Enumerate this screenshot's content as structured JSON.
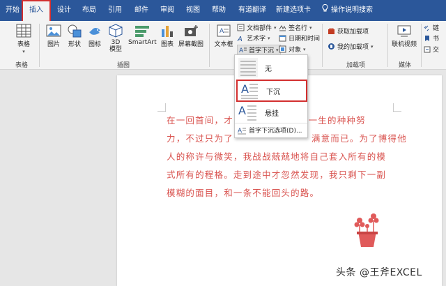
{
  "tabs": [
    "开始",
    "插入",
    "设计",
    "布局",
    "引用",
    "邮件",
    "审阅",
    "视图",
    "帮助",
    "有道翻译",
    "新建选项卡",
    "操作说明搜索"
  ],
  "ribbon": {
    "table": "表格",
    "pictures": "图片",
    "shapes": "形状",
    "icons": "图标",
    "models3d": "3D\n模型",
    "smartart": "SmartArt",
    "chart": "图表",
    "screenshot": "屏幕截图",
    "textbox": "文本框",
    "docparts": "文档部件",
    "wordart": "艺术字",
    "dropcap": "首字下沉",
    "signature": "签名行",
    "datetime": "日期和时间",
    "object": "对象",
    "get_addins": "获取加载项",
    "my_addins": "我的加载项",
    "online_video": "联机视频",
    "link": "链",
    "bookmark": "书",
    "crossref": "交",
    "group_tables": "表格",
    "group_illustrations": "插图",
    "group_addins": "加载项",
    "group_media": "媒体"
  },
  "dropcap_menu": {
    "none": "无",
    "dropped": "下沉",
    "in_margin": "悬挂",
    "options": "首字下沉选项(D)..."
  },
  "doc": {
    "lines": [
      "在一回首间，才",
      "力，不过只为了",
      "人的称许与微笑，我战战兢兢地将自己套入所有的模",
      "式所有的程格。走到途中才忽然发现，我只剩下一副",
      "模糊的面目，和一条不能回头的路。"
    ],
    "line1_tail": "我一生的种种努",
    "line2_tail": "满意而已。为了博得他"
  },
  "watermark": "头条 @王斧EXCEL",
  "colors": {
    "tab_bar": "#2b579a",
    "highlight_box": "#d32f2f",
    "doc_text": "#d9534f"
  }
}
